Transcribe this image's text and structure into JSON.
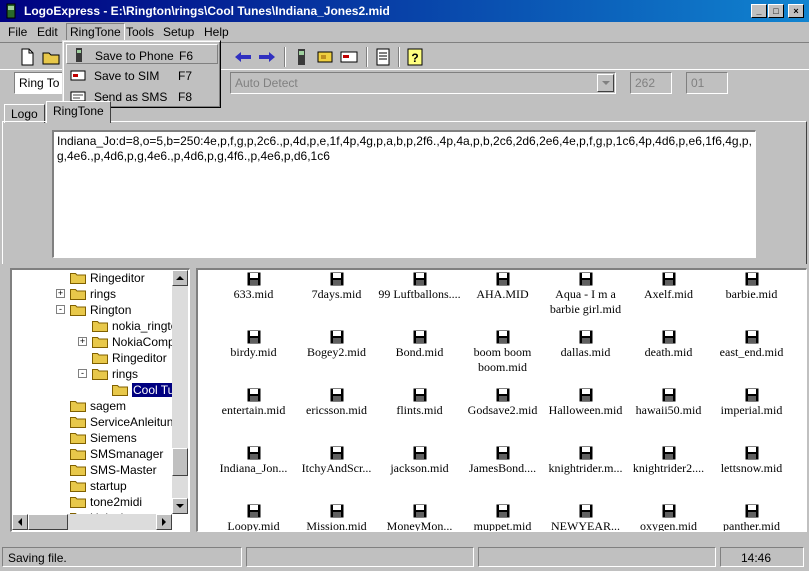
{
  "window": {
    "title": "LogoExpress - E:\\Rington\\rings\\Cool Tunes\\Indiana_Jones2.mid",
    "minimize": "_",
    "maximize": "□",
    "close": "×"
  },
  "menu": [
    "File",
    "Edit",
    "RingTone",
    "Tools",
    "Setup",
    "Help"
  ],
  "ringtone_menu": [
    {
      "label": "Save to Phone",
      "shortcut": "F6"
    },
    {
      "label": "Save to SIM",
      "shortcut": "F7"
    },
    {
      "label": "Send as SMS",
      "shortcut": "F8"
    }
  ],
  "combos": {
    "type": "Ring To",
    "detect": "Auto Detect",
    "num1": "262",
    "num2": "01"
  },
  "tabs": [
    "Logo",
    "RingTone"
  ],
  "ringtone_text": "Indiana_Jo:d=8,o=5,b=250:4e,p,f,g,p,2c6.,p,4d,p,e,1f,4p,4g,p,a,b,p,2f6.,4p,4a,p,b,2c6,2d6,2e6,4e,p,f,g,p,1c6,4p,4d6,p,e6,1f6,4g,p,g,4e6.,p,4d6,p,g,4e6.,p,4d6,p,g,4f6.,p,4e6,p,d6,1c6",
  "tree": [
    {
      "label": "Ringeditor",
      "expander": ""
    },
    {
      "label": "rings",
      "expander": "+"
    },
    {
      "label": "Rington",
      "expander": "-"
    },
    {
      "label": "nokia_ringto",
      "expander": ""
    },
    {
      "label": "NokiaCompo",
      "expander": "+"
    },
    {
      "label": "Ringeditor",
      "expander": ""
    },
    {
      "label": "rings",
      "expander": "-"
    },
    {
      "label": "Cool Tu",
      "expander": ""
    },
    {
      "label": "sagem",
      "expander": ""
    },
    {
      "label": "ServiceAnleitung",
      "expander": ""
    },
    {
      "label": "Siemens",
      "expander": ""
    },
    {
      "label": "SMSmanager",
      "expander": ""
    },
    {
      "label": "SMS-Master",
      "expander": ""
    },
    {
      "label": "startup",
      "expander": ""
    },
    {
      "label": "tone2midi",
      "expander": ""
    },
    {
      "label": "Unlock",
      "expander": ""
    }
  ],
  "files": [
    [
      "633.mid",
      "7days.mid",
      "99 Luftballons....",
      "AHA.MID",
      "Aqua - I m a barbie girl.mid",
      "Axelf.mid",
      "barbie.mid"
    ],
    [
      "birdy.mid",
      "Bogey2.mid",
      "Bond.mid",
      "boom boom boom.mid",
      "dallas.mid",
      "death.mid",
      "east_end.mid"
    ],
    [
      "entertain.mid",
      "ericsson.mid",
      "flints.mid",
      "Godsave2.mid",
      "Halloween.mid",
      "hawaii50.mid",
      "imperial.mid"
    ],
    [
      "Indiana_Jon...",
      "ItchyAndScr...",
      "jackson.mid",
      "JamesBond....",
      "knightrider.m...",
      "knightrider2....",
      "lettsnow.mid"
    ],
    [
      "Loopy.mid",
      "Mission.mid",
      "MoneyMon...",
      "muppet.mid",
      "NEWYEAR...",
      "oxygen.mid",
      "panther.mid"
    ]
  ],
  "status": {
    "message": "Saving file.",
    "time": "14:46"
  },
  "colors": {
    "title_start": "#000080",
    "title_end": "#1084d0",
    "face": "#c0c0c0",
    "selection": "#000080"
  }
}
